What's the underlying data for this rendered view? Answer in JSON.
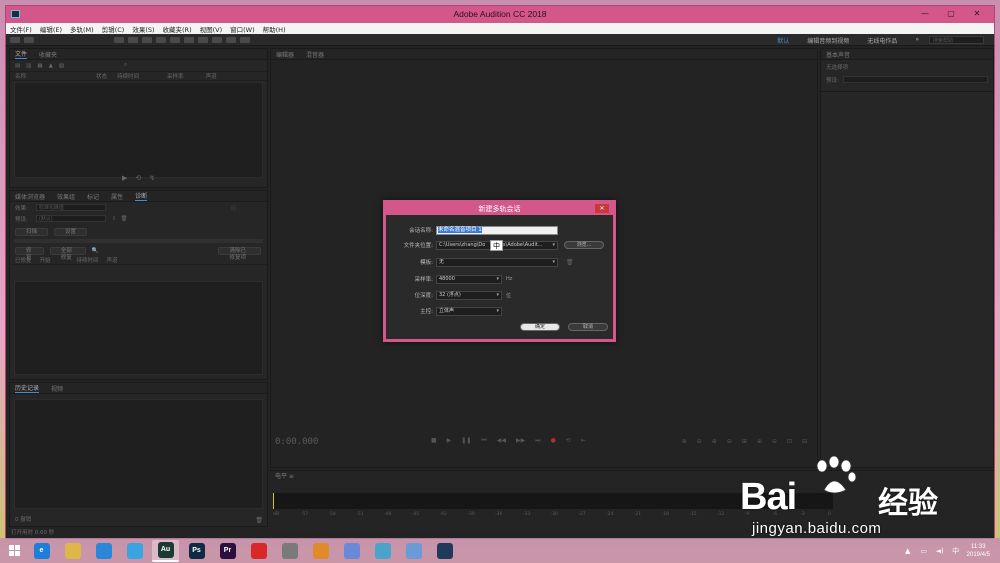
{
  "window": {
    "title": "Adobe Audition CC 2018"
  },
  "menu": [
    "文件(F)",
    "编辑(E)",
    "多轨(M)",
    "剪辑(C)",
    "效果(S)",
    "收藏夹(R)",
    "视图(V)",
    "窗口(W)",
    "帮助(H)"
  ],
  "workspaces": {
    "items": [
      "默认",
      "编辑音频到视频",
      "无线电作品"
    ],
    "search_placeholder": "搜索帮助"
  },
  "files_panel": {
    "tabs": [
      "文件",
      "收藏夹"
    ],
    "columns": [
      "名称",
      "状态",
      "持续时间",
      "采样率",
      "声道"
    ]
  },
  "effects_panel": {
    "tabs": [
      "媒体浏览器",
      "效果组",
      "标记",
      "属性",
      "诊断"
    ],
    "field_effect_label": "效果:",
    "field_effect_value": "标准化峰值",
    "field_preset_label": "预设:",
    "field_preset_value": "(默认)",
    "btn_scan": "扫描",
    "btn_settings": "设置",
    "btn_fix": "修复",
    "btn_fix_all": "全部修复",
    "btn_clear": "清除已修复项",
    "columns": [
      "已修复",
      "开始",
      "持续时间",
      "声道"
    ]
  },
  "history_panel": {
    "tabs": [
      "历史记录",
      "视频"
    ],
    "status": "0 撤销"
  },
  "status_bar": {
    "text": "打开用时 0.60 秒"
  },
  "editor": {
    "tabs": [
      "编辑器",
      "混音器"
    ],
    "time": "0:00.000"
  },
  "right_panel": {
    "tabs": [
      "基本声音"
    ],
    "sub_label": "无选择项",
    "preset_label": "预设:"
  },
  "meter": {
    "scale": [
      "dB",
      "-57",
      "-54",
      "-51",
      "-48",
      "-45",
      "-42",
      "-39",
      "-36",
      "-33",
      "-30",
      "-27",
      "-24",
      "-21",
      "-18",
      "-15",
      "-12",
      "-9",
      "-6",
      "-3",
      "0"
    ]
  },
  "dialog": {
    "title": "新建多轨会话",
    "session_label": "会话名称:",
    "session_value": "未命名混音项目 1",
    "folder_label": "文件夹位置:",
    "folder_value": "C:\\Users\\zhang\\Do",
    "folder_value_tail": "ts\\Adobe\\Audit...",
    "browse": "浏览...",
    "template_label": "模板:",
    "template_value": "无",
    "samplerate_label": "采样率:",
    "samplerate_value": "48000",
    "samplerate_unit": "Hz",
    "bitdepth_label": "位深度:",
    "bitdepth_value": "32 (浮点)",
    "bitdepth_unit": "位",
    "master_label": "主控:",
    "master_value": "立体声",
    "ok": "确定",
    "cancel": "取消",
    "ime": "中"
  },
  "watermark": {
    "bai": "Bai",
    "jy": "经验",
    "url": "jingyan.baidu.com"
  },
  "taskbar": {
    "apps": [
      {
        "name": "ie",
        "label": "e",
        "color": "#1f7fd8"
      },
      {
        "name": "explorer",
        "label": "",
        "color": "#e0b64a"
      },
      {
        "name": "browser",
        "label": "",
        "color": "#2a86d8"
      },
      {
        "name": "cloud",
        "label": "",
        "color": "#3aa3e0"
      },
      {
        "name": "audition",
        "label": "Au",
        "color": "#1d3a32"
      },
      {
        "name": "photoshop",
        "label": "Ps",
        "color": "#0f2a44"
      },
      {
        "name": "premiere",
        "label": "Pr",
        "color": "#2b0f3d"
      },
      {
        "name": "netease",
        "label": "",
        "color": "#d82828"
      },
      {
        "name": "app9",
        "label": "",
        "color": "#7a7a7a"
      },
      {
        "name": "app10",
        "label": "",
        "color": "#e08a2a"
      },
      {
        "name": "app11",
        "label": "",
        "color": "#6a8ad8"
      },
      {
        "name": "app12",
        "label": "",
        "color": "#4aa3c8"
      },
      {
        "name": "app13",
        "label": "",
        "color": "#6a9ad8"
      },
      {
        "name": "app14",
        "label": "",
        "color": "#1f3a5a"
      }
    ],
    "time": "11:33",
    "date": "2019/4/5"
  }
}
